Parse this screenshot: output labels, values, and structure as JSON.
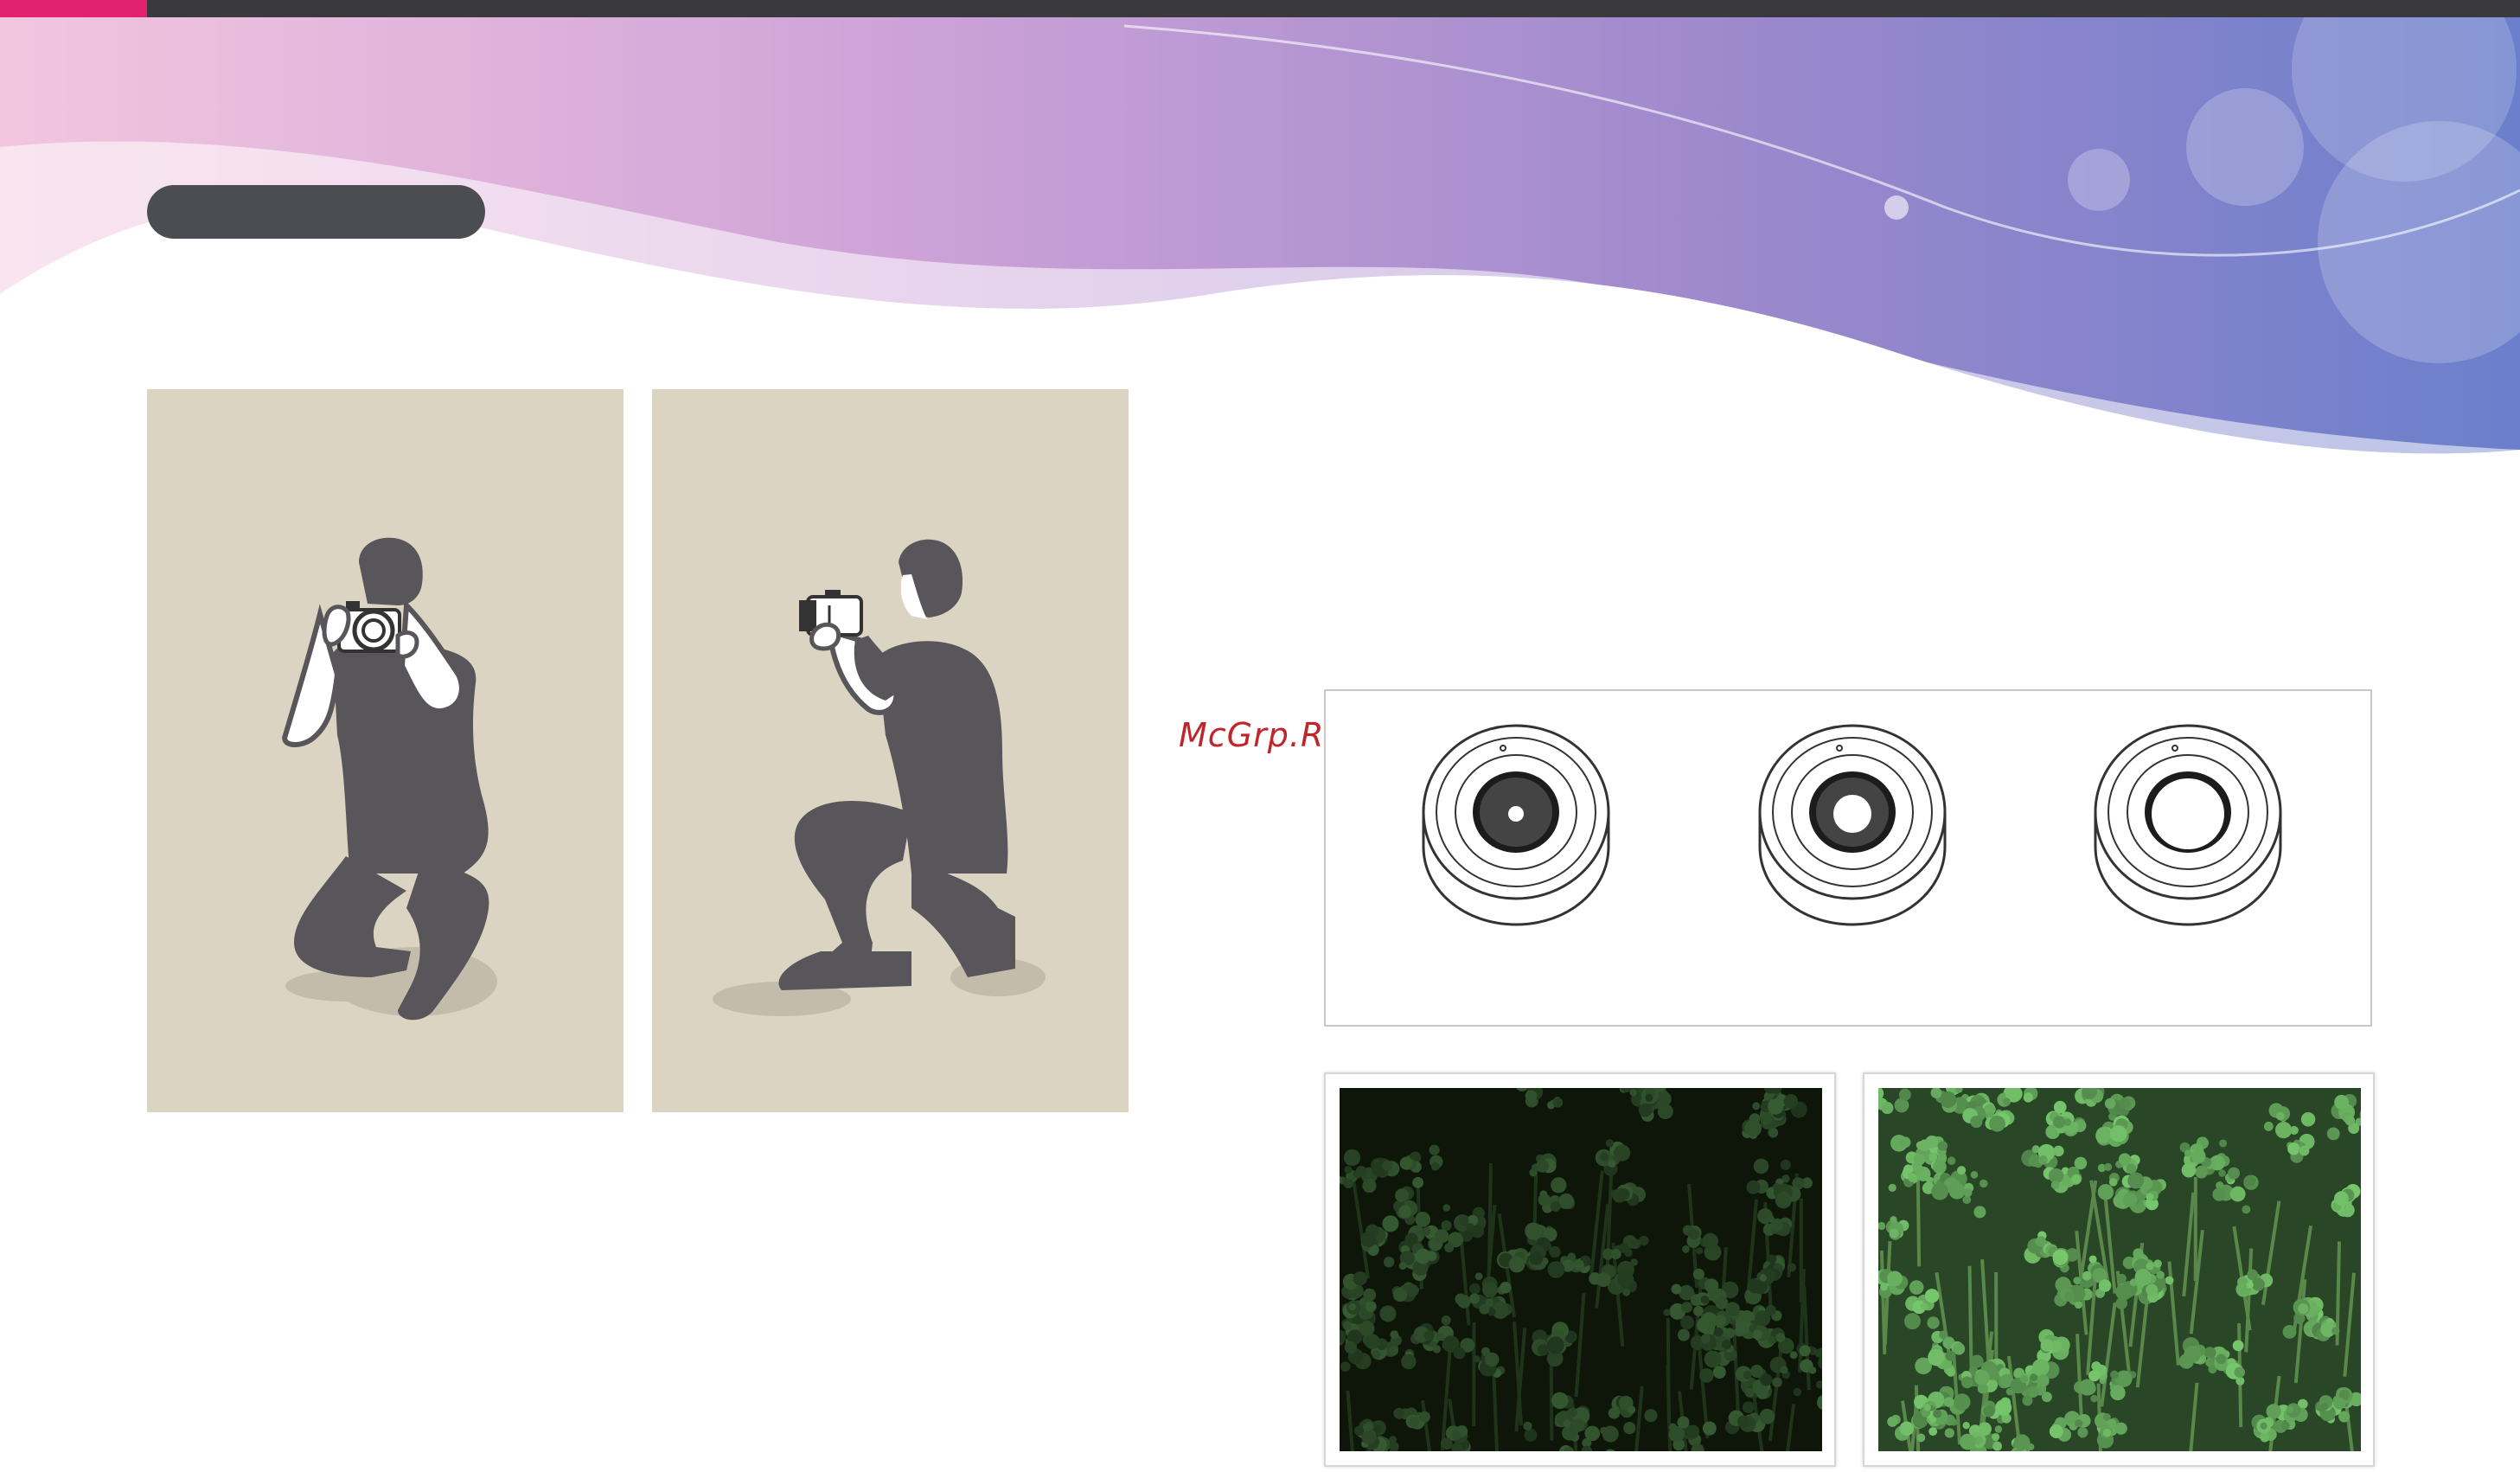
{
  "watermark": {
    "text": "McGrp.Ru"
  },
  "colors": {
    "accent": "#e0226f",
    "topbar": "#3a3a3e",
    "pill": "#4b4d52",
    "panel_bg": "#dbd4c3",
    "silhouette": "#58565a",
    "watermark": "#c0252b"
  },
  "illustrations": [
    {
      "name": "photographer-crouching-front",
      "icon": "photographer-icon"
    },
    {
      "name": "photographer-kneeling-side",
      "icon": "photographer-icon"
    }
  ],
  "lens_apertures": [
    {
      "name": "aperture-small",
      "icon": "lens-icon"
    },
    {
      "name": "aperture-medium",
      "icon": "lens-icon"
    },
    {
      "name": "aperture-wide",
      "icon": "lens-icon"
    }
  ],
  "photos": [
    {
      "name": "plants-photo-dark",
      "tone": "dark"
    },
    {
      "name": "plants-photo-bright",
      "tone": "bright"
    }
  ]
}
